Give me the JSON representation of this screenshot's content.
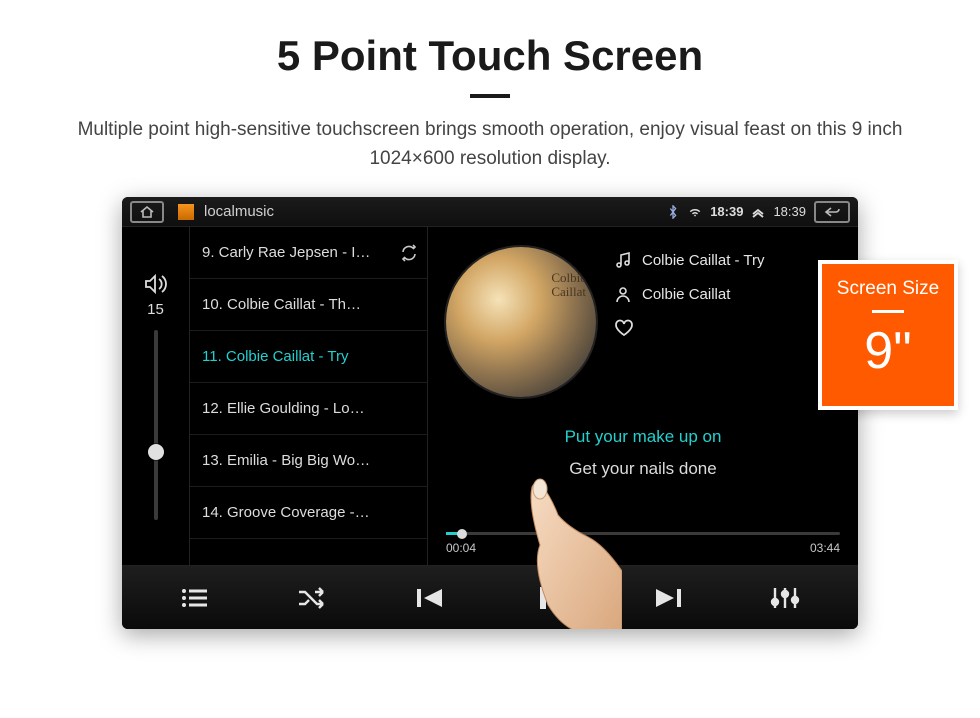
{
  "headline": "5 Point Touch Screen",
  "subhead": "Multiple point high-sensitive touchscreen brings smooth operation, enjoy visual feast on this 9 inch 1024×600 resolution display.",
  "status": {
    "app_title": "localmusic",
    "time_primary": "18:39",
    "time_secondary": "18:39"
  },
  "volume": {
    "value": "15"
  },
  "playlist": [
    {
      "label": "9. Carly Rae Jepsen - I…",
      "current": false,
      "repeat": true
    },
    {
      "label": "10. Colbie Caillat - Th…",
      "current": false,
      "repeat": false
    },
    {
      "label": "11. Colbie Caillat - Try",
      "current": true,
      "repeat": false
    },
    {
      "label": "12. Ellie Goulding - Lo…",
      "current": false,
      "repeat": false
    },
    {
      "label": "13. Emilia - Big Big Wo…",
      "current": false,
      "repeat": false
    },
    {
      "label": "14. Groove Coverage -…",
      "current": false,
      "repeat": false
    }
  ],
  "nowplaying": {
    "song": "Colbie Caillat - Try",
    "artist": "Colbie Caillat",
    "lyric_active": "Put your make up on",
    "lyric_next": "Get your nails done",
    "elapsed": "00:04",
    "total": "03:44"
  },
  "tag": {
    "title": "Screen Size",
    "value": "9\""
  }
}
